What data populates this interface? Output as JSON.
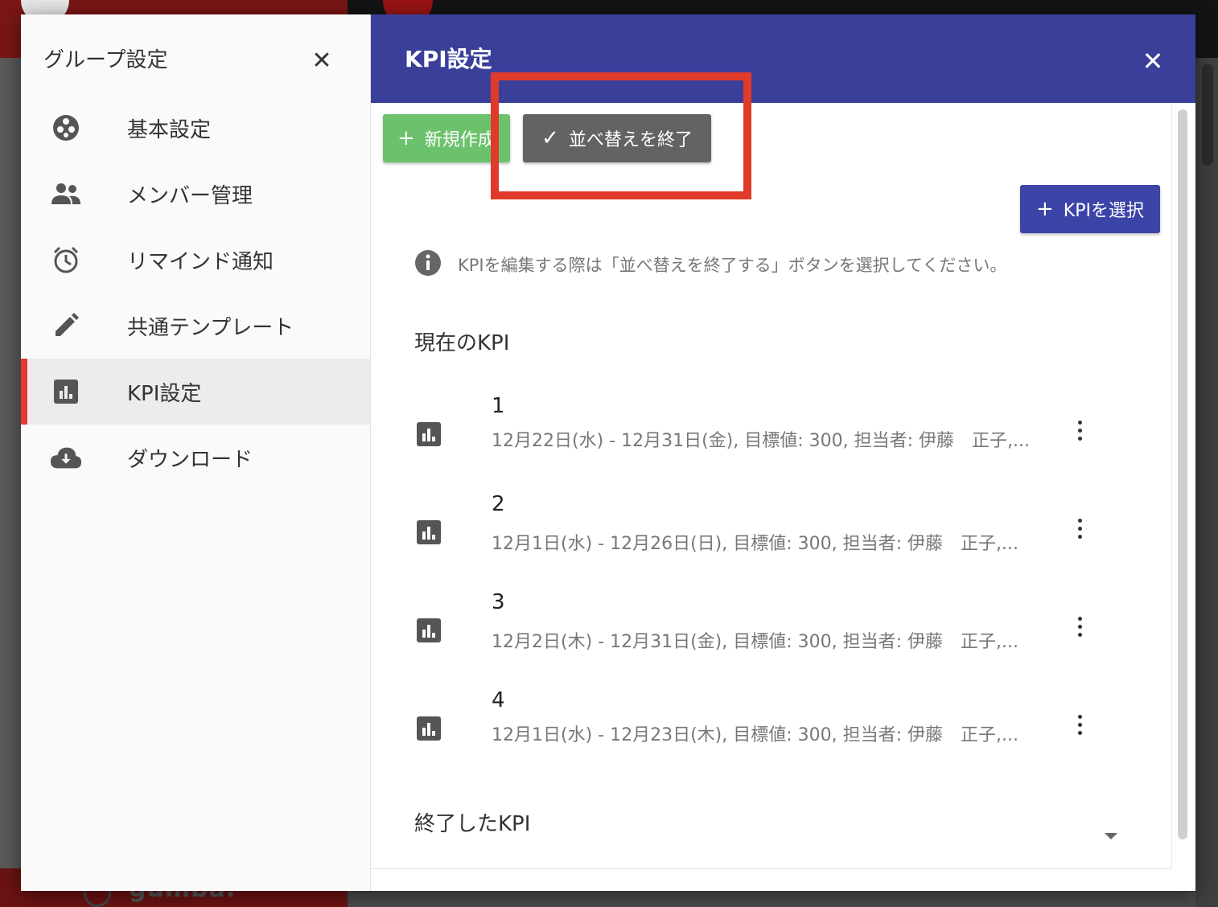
{
  "background": {
    "bottom_text": "gumba."
  },
  "sidebar": {
    "title": "グループ設定",
    "close_glyph": "✕",
    "items": [
      {
        "label": "基本設定",
        "icon": "settings-cog-icon",
        "active": false
      },
      {
        "label": "メンバー管理",
        "icon": "people-icon",
        "active": false
      },
      {
        "label": "リマインド通知",
        "icon": "alarm-clock-icon",
        "active": false
      },
      {
        "label": "共通テンプレート",
        "icon": "pencil-icon",
        "active": false
      },
      {
        "label": "KPI設定",
        "icon": "bar-chart-icon",
        "active": true
      },
      {
        "label": "ダウンロード",
        "icon": "cloud-download-icon",
        "active": false
      }
    ]
  },
  "main": {
    "title": "KPI設定",
    "close_glyph": "✕",
    "buttons": {
      "new_glyph": "+",
      "new_label": "新規作成",
      "sort_glyph": "✓",
      "sort_label": "並べ替えを終了",
      "select_glyph": "+",
      "select_label": "KPIを選択"
    },
    "info_text": "KPIを編集する際は「並べ替えを終了する」ボタンを選択してください。",
    "current_section_title": "現在のKPI",
    "kpis": [
      {
        "name": "1",
        "detail": "12月22日(水) - 12月31日(金), 目標値: 300, 担当者: 伊藤　正子,..."
      },
      {
        "name": "2",
        "detail": "12月1日(水) - 12月26日(日), 目標値: 300, 担当者: 伊藤　正子,..."
      },
      {
        "name": "3",
        "detail": "12月2日(木) - 12月31日(金), 目標値: 300, 担当者: 伊藤　正子,..."
      },
      {
        "name": "4",
        "detail": "12月1日(水) - 12月23日(木), 目標値: 300, 担当者: 伊藤　正子,..."
      }
    ],
    "ended_section_title": "終了したKPI"
  },
  "colors": {
    "header_bg": "#3a3f99",
    "new_button": "#6cc26c",
    "sort_button": "#636363",
    "select_button": "#3c44a8",
    "highlight": "#e03a2a",
    "active_indicator": "#e53935"
  }
}
